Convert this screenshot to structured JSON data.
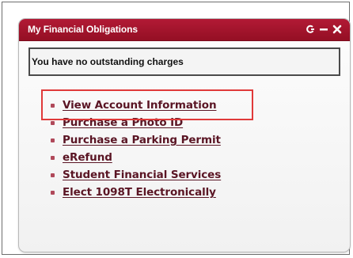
{
  "widget": {
    "title": "My Financial Obligations",
    "controls": [
      {
        "name": "refresh-icon",
        "glyph": "refresh"
      },
      {
        "name": "minimize-icon",
        "glyph": "minus"
      },
      {
        "name": "close-icon",
        "glyph": "x"
      }
    ],
    "status_message": "You have no outstanding charges",
    "links": [
      "View Account Information",
      "Purchase a Photo ID",
      "Purchase a Parking Permit",
      "eRefund",
      "Student Financial Services",
      "Elect 1098T Electronically"
    ],
    "highlighted_link_index": 0
  },
  "colors": {
    "header": "#a3152d",
    "link": "#5a1524",
    "bullet": "#b0495a",
    "highlight": "#e03a3a"
  }
}
